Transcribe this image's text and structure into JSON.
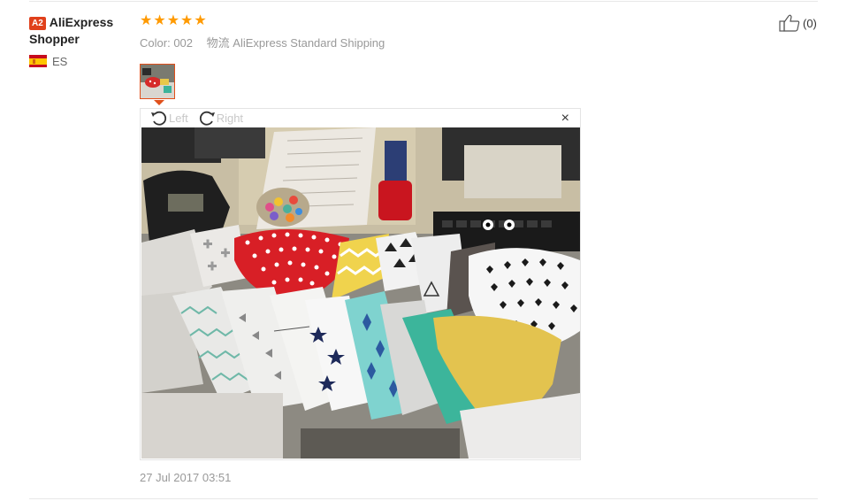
{
  "user": {
    "level_badge": "A2",
    "name": "AliExpress Shopper",
    "country_code": "ES",
    "flag_icon": "spain-flag-icon"
  },
  "review": {
    "rating": 5,
    "rating_max": 5,
    "color_label": "Color:",
    "color_value": "002",
    "shipping_label": "物流",
    "shipping_value": "AliExpress Standard Shipping",
    "date": "27 Jul 2017 03:51"
  },
  "viewer": {
    "rotate_left_label": "Left",
    "rotate_right_label": "Right",
    "close_symbol": "×"
  },
  "helpful": {
    "icon": "thumbs-up-icon",
    "count": "(0)"
  },
  "colors": {
    "accent": "#e0501b",
    "star": "#ff9a00",
    "muted_text": "#999999"
  }
}
